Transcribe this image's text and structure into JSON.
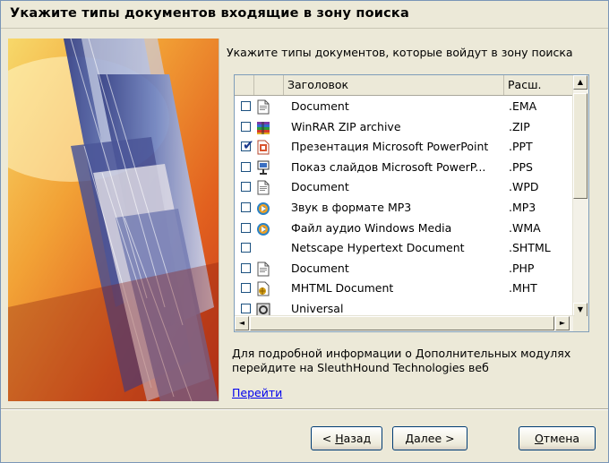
{
  "window": {
    "title": "Укажите типы документов входящие в зону поиска"
  },
  "page": {
    "instruction": "Укажите типы документов, которые войдут в зону поиска",
    "info_text": "Для подробной информации о Дополнительных модулях перейдите на SleuthHound Technologies веб",
    "link_label": "Перейти"
  },
  "list": {
    "columns": [
      "Заголовок",
      "Расш."
    ],
    "rows": [
      {
        "name": "Document",
        "ext": ".EMA",
        "checked": false,
        "icon": "document-icon"
      },
      {
        "name": "WinRAR ZIP archive",
        "ext": ".ZIP",
        "checked": false,
        "icon": "winrar-icon"
      },
      {
        "name": "Презентация Microsoft PowerPoint",
        "ext": ".PPT",
        "checked": true,
        "icon": "powerpoint-icon"
      },
      {
        "name": "Показ слайдов Microsoft PowerP...",
        "ext": ".PPS",
        "checked": false,
        "icon": "slideshow-icon"
      },
      {
        "name": "Document",
        "ext": ".WPD",
        "checked": false,
        "icon": "document-icon"
      },
      {
        "name": "Звук в формате MP3",
        "ext": ".MP3",
        "checked": false,
        "icon": "media-player-icon"
      },
      {
        "name": "Файл аудио Windows Media",
        "ext": ".WMA",
        "checked": false,
        "icon": "media-player-icon"
      },
      {
        "name": "Netscape Hypertext Document",
        "ext": ".SHTML",
        "checked": false,
        "icon": ""
      },
      {
        "name": "Document",
        "ext": ".PHP",
        "checked": false,
        "icon": "document-icon"
      },
      {
        "name": "MHTML Document",
        "ext": ".MHT",
        "checked": false,
        "icon": "mhtml-icon"
      },
      {
        "name": "Universal",
        "ext": "",
        "checked": false,
        "icon": "universal-icon"
      }
    ]
  },
  "buttons": {
    "back_mnemonic": "Н",
    "back_rest": "азад",
    "next_mnemonic": "Д",
    "next_rest": "алее",
    "cancel_mnemonic": "О",
    "cancel_rest": "тмена"
  },
  "colors": {
    "dialog_bg": "#ece9d8",
    "link": "#0000ee",
    "list_border": "#7f9db9"
  }
}
